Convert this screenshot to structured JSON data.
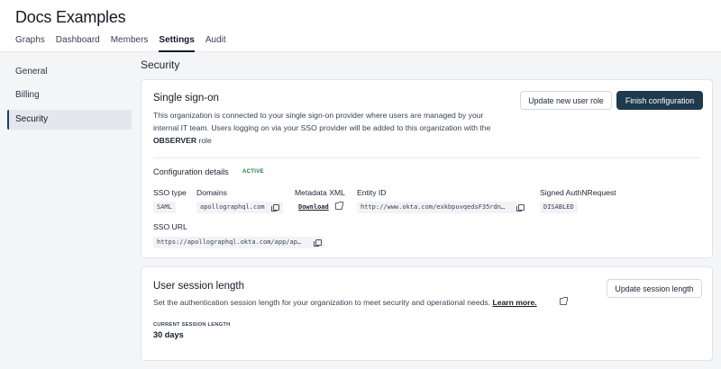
{
  "app": {
    "title": "Docs Examples"
  },
  "nav": {
    "tabs": [
      {
        "label": "Graphs"
      },
      {
        "label": "Dashboard"
      },
      {
        "label": "Members"
      },
      {
        "label": "Settings"
      },
      {
        "label": "Audit"
      }
    ]
  },
  "sidebar": {
    "items": [
      {
        "label": "General"
      },
      {
        "label": "Billing"
      },
      {
        "label": "Security"
      }
    ]
  },
  "page": {
    "heading": "Security"
  },
  "sso": {
    "title": "Single sign-on",
    "desc_pre": "This organization is connected to your single sign-on provider where users are managed by your internal IT team. Users logging on via your SSO provider will be added to this organization with the ",
    "desc_role": "OBSERVER",
    "desc_post": " role",
    "btn_update_role": "Update new user role",
    "btn_finish": "Finish configuration",
    "config_title": "Configuration details",
    "config_status": "ACTIVE",
    "fields": {
      "sso_type_label": "SSO type",
      "sso_type_value": "SAML",
      "domains_label": "Domains",
      "domains_value": "apollographql.com",
      "metadata_label": "Metadata XML",
      "metadata_link": "Download",
      "entity_label": "Entity ID",
      "entity_value": "http://www.okta.com/exkbpuvqedsF35rdn…",
      "signed_label": "Signed AuthNRequest",
      "signed_value": "DISABLED",
      "sso_url_label": "SSO URL",
      "sso_url_value": "https://apollographql.okta.com/app/ap…"
    }
  },
  "session": {
    "title": "User session length",
    "desc": "Set the authentication session length for your organization to meet security and operational needs.",
    "learn_more": "Learn more.",
    "btn_update": "Update session length",
    "current_label": "CURRENT SESSION LENGTH",
    "current_value": "30 days"
  }
}
